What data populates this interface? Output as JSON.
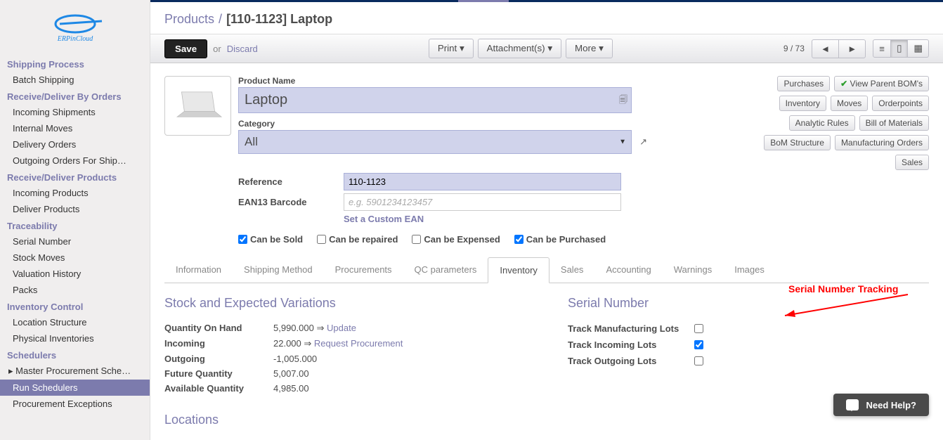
{
  "header": {
    "crumb_products": "Products",
    "crumb_title": "[110-1123] Laptop"
  },
  "toolbar": {
    "save": "Save",
    "or": "or",
    "discard": "Discard",
    "print": "Print",
    "attachments": "Attachment(s)",
    "more": "More",
    "pager": "9 / 73"
  },
  "view_buttons": {
    "list": "≡",
    "form": "▭",
    "kanban": "⊞"
  },
  "form": {
    "product_name_label": "Product Name",
    "product_name": "Laptop",
    "category_label": "Category",
    "category": "All",
    "reference_label": "Reference",
    "reference": "110-1123",
    "ean_label": "EAN13 Barcode",
    "ean_placeholder": "e.g. 5901234123457",
    "set_custom_ean": "Set a Custom EAN"
  },
  "side_buttons": {
    "purchases": "Purchases",
    "view_parent_bom": "View Parent BOM's",
    "inventory": "Inventory",
    "moves": "Moves",
    "orderpoints": "Orderpoints",
    "analytic_rules": "Analytic Rules",
    "bill_of_materials": "Bill of Materials",
    "bom_structure": "BoM Structure",
    "manufacturing_orders": "Manufacturing Orders",
    "sales": "Sales"
  },
  "checkboxes": {
    "can_sold": "Can be Sold",
    "can_repaired": "Can be repaired",
    "can_expensed": "Can be Expensed",
    "can_purchased": "Can be Purchased"
  },
  "tabs": {
    "information": "Information",
    "shipping": "Shipping Method",
    "procurements": "Procurements",
    "qc": "QC parameters",
    "inventory": "Inventory",
    "sales": "Sales",
    "accounting": "Accounting",
    "warnings": "Warnings",
    "images": "Images"
  },
  "stock": {
    "heading": "Stock and Expected Variations",
    "qoh_label": "Quantity On Hand",
    "qoh": "5,990.000",
    "update": "Update",
    "incoming_label": "Incoming",
    "incoming": "22.000",
    "request_proc": "Request Procurement",
    "outgoing_label": "Outgoing",
    "outgoing": "-1,005.000",
    "future_label": "Future Quantity",
    "future": "5,007.00",
    "avail_label": "Available Quantity",
    "avail": "4,985.00",
    "locations": "Locations"
  },
  "serial": {
    "heading": "Serial Number",
    "manuf": "Track Manufacturing Lots",
    "incoming": "Track Incoming Lots",
    "outgoing": "Track Outgoing Lots"
  },
  "annotation": "Serial Number Tracking",
  "sidebar": {
    "logo": "ERPinCloud",
    "sections": [
      {
        "heading": "Shipping Process",
        "items": [
          "Batch Shipping"
        ]
      },
      {
        "heading": "Receive/Deliver By Orders",
        "items": [
          "Incoming Shipments",
          "Internal Moves",
          "Delivery Orders",
          "Outgoing Orders For Ship…"
        ]
      },
      {
        "heading": "Receive/Deliver Products",
        "items": [
          "Incoming Products",
          "Deliver Products"
        ]
      },
      {
        "heading": "Traceability",
        "items": [
          "Serial Number",
          "Stock Moves",
          "Valuation History",
          "Packs"
        ]
      },
      {
        "heading": "Inventory Control",
        "items": [
          "Location Structure",
          "Physical Inventories"
        ]
      },
      {
        "heading": "Schedulers",
        "items": [
          "Master Procurement Sche…",
          "Run Schedulers",
          "Procurement Exceptions"
        ]
      }
    ]
  },
  "need_help": "Need Help?",
  "arrow": "⇒"
}
